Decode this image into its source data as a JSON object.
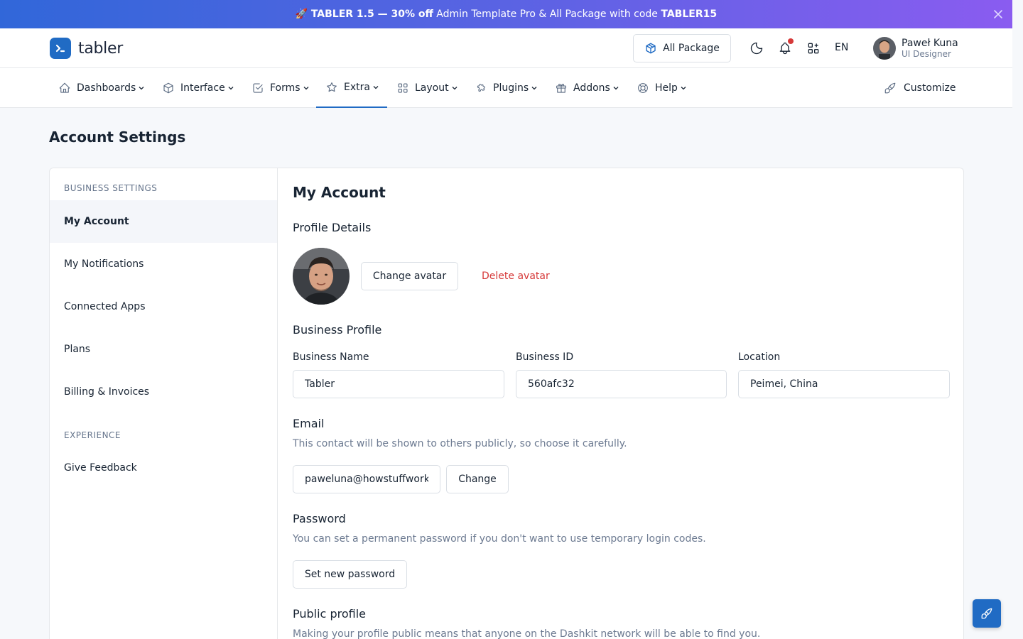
{
  "banner": {
    "emoji": "🚀",
    "brand": "TABLER 1.5",
    "dash": " — ",
    "discount": "30% off",
    "text": " Admin Template Pro & All Package with code ",
    "code": "TABLER15"
  },
  "header": {
    "logo_text": "tabler",
    "package_label": "All Package",
    "language": "EN",
    "user_name": "Paweł Kuna",
    "user_role": "UI Designer"
  },
  "nav": {
    "items": [
      {
        "label": "Dashboards",
        "icon": "home-icon"
      },
      {
        "label": "Interface",
        "icon": "package-icon"
      },
      {
        "label": "Forms",
        "icon": "checkbox-icon"
      },
      {
        "label": "Extra",
        "icon": "star-icon"
      },
      {
        "label": "Layout",
        "icon": "layout-grid-icon"
      },
      {
        "label": "Plugins",
        "icon": "puzzle-icon"
      },
      {
        "label": "Addons",
        "icon": "gift-icon"
      },
      {
        "label": "Help",
        "icon": "lifebuoy-icon"
      }
    ],
    "active": "Extra",
    "customize_label": "Customize"
  },
  "page": {
    "title": "Account Settings"
  },
  "sidebar": {
    "section1": "Business settings",
    "items1": [
      "My Account",
      "My Notifications",
      "Connected Apps",
      "Plans",
      "Billing & Invoices"
    ],
    "section2": "Experience",
    "items2": [
      "Give Feedback"
    ],
    "active": "My Account"
  },
  "account": {
    "title": "My Account",
    "profile_details": "Profile Details",
    "change_avatar": "Change avatar",
    "delete_avatar": "Delete avatar",
    "business_profile": "Business Profile",
    "business_name_label": "Business Name",
    "business_name_value": "Tabler",
    "business_id_label": "Business ID",
    "business_id_value": "560afc32",
    "location_label": "Location",
    "location_value": "Peimei, China",
    "email_heading": "Email",
    "email_desc": "This contact will be shown to others publicly, so choose it carefully.",
    "email_value": "paweluna@howstuffworks.com",
    "email_change": "Change",
    "password_heading": "Password",
    "password_desc": "You can set a permanent password if you don't want to use temporary login codes.",
    "password_button": "Set new password",
    "public_heading": "Public profile",
    "public_desc": "Making your profile public means that anyone on the Dashkit network will be able to find you."
  },
  "colors": {
    "primary": "#206bc4",
    "danger": "#d63939",
    "text": "#182433",
    "muted": "#6c7a91",
    "border": "#dadfe5",
    "background": "#f6f8fb"
  }
}
